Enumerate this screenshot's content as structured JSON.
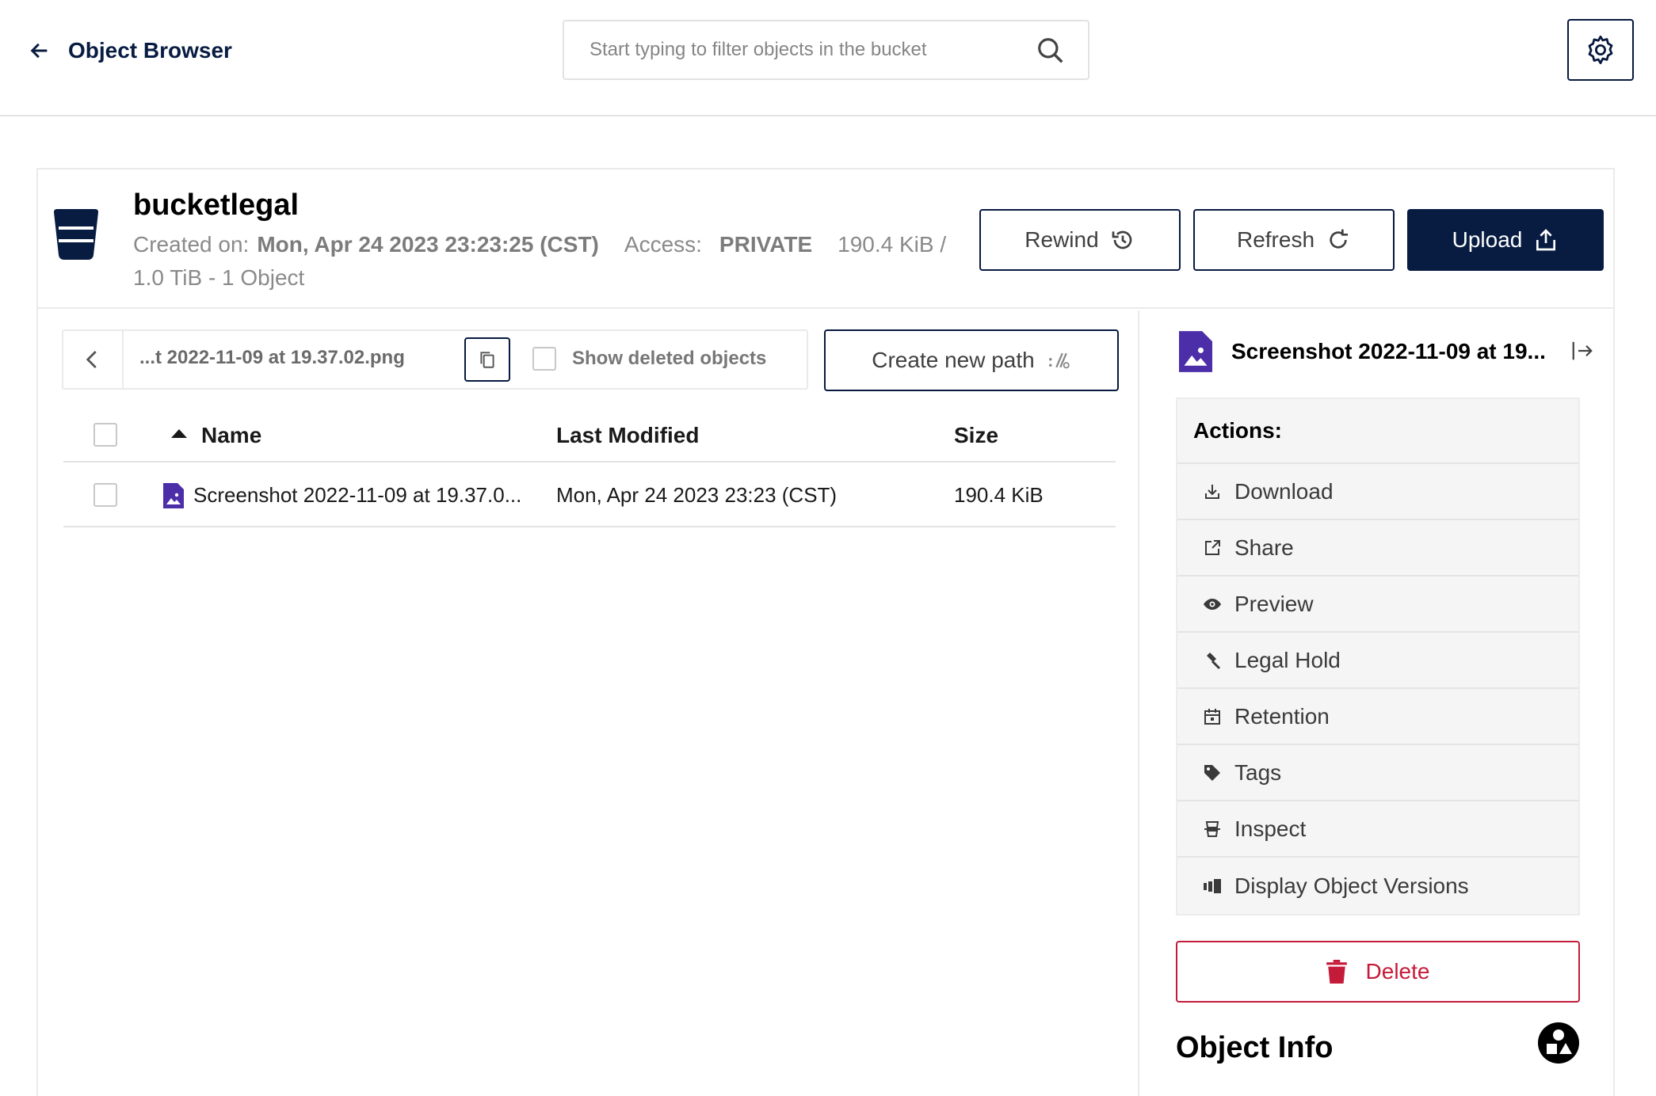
{
  "topbar": {
    "title": "Object Browser",
    "search_placeholder": "Start typing to filter objects in the bucket"
  },
  "bucket": {
    "name": "bucketlegal",
    "created_label": "Created on:",
    "created_value": "Mon, Apr 24 2023 23:23:25 (CST)",
    "access_label": "Access:",
    "access_value": "PRIVATE",
    "usage": "190.4 KiB / 1.0 TiB - 1 Object"
  },
  "header_buttons": {
    "rewind": "Rewind",
    "refresh": "Refresh",
    "upload": "Upload"
  },
  "pathbar": {
    "path": "...t 2022-11-09 at 19.37.02.png",
    "show_deleted": "Show deleted objects",
    "create_path": "Create new path"
  },
  "table": {
    "columns": [
      "Name",
      "Last Modified",
      "Size"
    ],
    "rows": [
      {
        "name": "Screenshot 2022-11-09 at 19.37.0...",
        "modified": "Mon, Apr 24 2023 23:23 (CST)",
        "size": "190.4 KiB"
      }
    ]
  },
  "details": {
    "file_name": "Screenshot 2022-11-09 at 19...",
    "actions_title": "Actions:",
    "actions": [
      {
        "label": "Download",
        "icon": "download-icon"
      },
      {
        "label": "Share",
        "icon": "share-icon"
      },
      {
        "label": "Preview",
        "icon": "eye-icon"
      },
      {
        "label": "Legal Hold",
        "icon": "gavel-icon"
      },
      {
        "label": "Retention",
        "icon": "calendar-icon"
      },
      {
        "label": "Tags",
        "icon": "tag-icon"
      },
      {
        "label": "Inspect",
        "icon": "inspect-icon"
      },
      {
        "label": "Display Object Versions",
        "icon": "versions-icon"
      }
    ],
    "delete": "Delete",
    "object_info": "Object Info"
  },
  "colors": {
    "navy": "#081c42",
    "file_icon": "#4b2ea8",
    "danger": "#c51b3a"
  }
}
